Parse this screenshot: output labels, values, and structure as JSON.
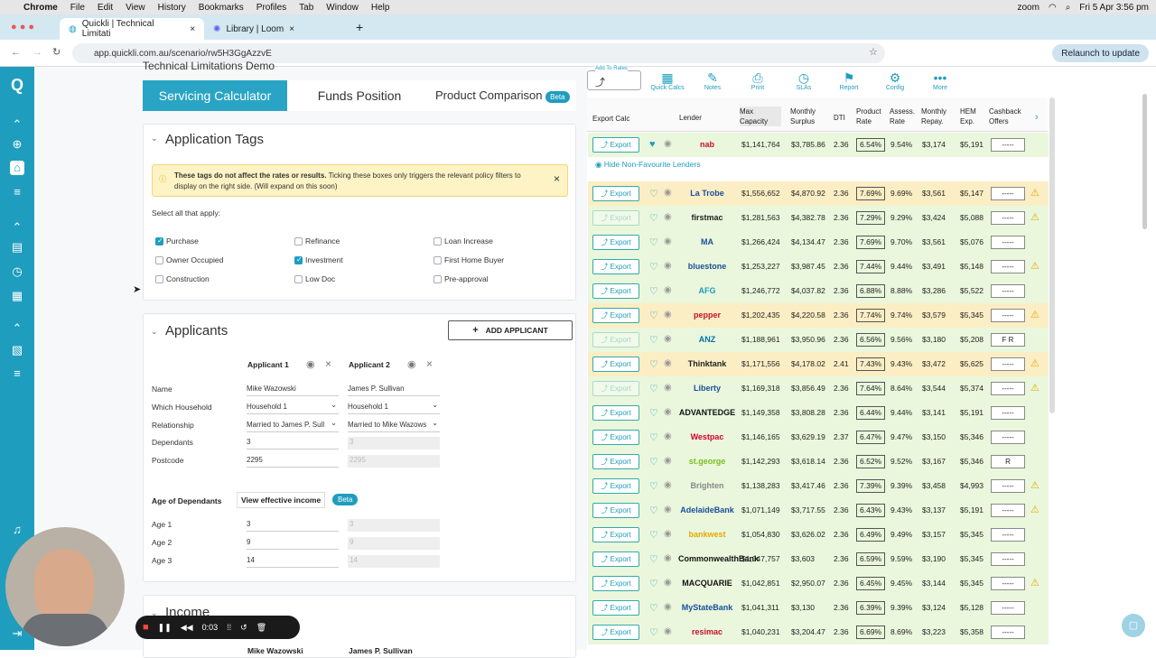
{
  "mac": {
    "menus": [
      "Chrome",
      "File",
      "Edit",
      "View",
      "History",
      "Bookmarks",
      "Profiles",
      "Tab",
      "Window",
      "Help"
    ],
    "clock": "Fri 5 Apr  3:56 pm",
    "zoom": "zoom"
  },
  "tabs": [
    {
      "title": "Quickli | Technical Limitati"
    },
    {
      "title": "Library | Loom"
    }
  ],
  "url": "app.quickli.com.au/scenario/rw5H3GgAzzvE",
  "relaunch": "Relaunch to update",
  "nav": {
    "tabs": [
      "Servicing Calculator",
      "Funds Position",
      "Product Comparison"
    ],
    "beta": "Beta",
    "partial_title": "Technical Limitations Demo"
  },
  "toolbar": {
    "add_to_rates": "Add To Rates",
    "items": [
      "Quick Calcs",
      "Notes",
      "Print",
      "SLAs",
      "Report",
      "Config",
      "More"
    ]
  },
  "tags": {
    "title": "Application Tags",
    "notice_bold": "These tags do not affect the rates or results.",
    "notice": " Ticking these boxes only triggers the relevant policy filters to display on the right side. (Will expand on this soon)",
    "select": "Select all that apply:",
    "options": [
      {
        "l": "Purchase",
        "on": true
      },
      {
        "l": "Refinance",
        "on": false
      },
      {
        "l": "Loan Increase",
        "on": false
      },
      {
        "l": "Owner Occupied",
        "on": false
      },
      {
        "l": "Investment",
        "on": true
      },
      {
        "l": "First Home Buyer",
        "on": false
      },
      {
        "l": "Construction",
        "on": false
      },
      {
        "l": "Low Doc",
        "on": false
      },
      {
        "l": "Pre-approval",
        "on": false
      }
    ]
  },
  "applicants": {
    "title": "Applicants",
    "add": "ADD APPLICANT",
    "a1": "Applicant 1",
    "a2": "Applicant 2",
    "labels": [
      "Name",
      "Which Household",
      "Relationship",
      "Dependants",
      "Postcode"
    ],
    "v1": [
      "Mike Wazowski",
      "Household 1",
      "Married to James P. Sull",
      "3",
      "2295"
    ],
    "v2": [
      "James P. Sullivan",
      "Household 1",
      "Married to Mike Wazows",
      "3",
      "2295"
    ],
    "age_title": "Age of Dependants",
    "view_eff": "View effective income",
    "beta": "Beta",
    "ages": [
      {
        "l": "Age 1",
        "v": "3"
      },
      {
        "l": "Age 2",
        "v": "9"
      },
      {
        "l": "Age 3",
        "v": "14"
      }
    ],
    "income": "Income",
    "inc_names": [
      "Mike Wazowski",
      "James P. Sullivan"
    ]
  },
  "loom": {
    "time": "0:03"
  },
  "table": {
    "headers": [
      "Export Calc",
      "Lender",
      "Max Capacity",
      "Monthly Surplus",
      "DTI",
      "Product Rate",
      "Assess. Rate",
      "Monthly Repay.",
      "HEM Exp.",
      "Cashback Offers"
    ],
    "hide": "Hide Non-Favourite Lenders",
    "export": "Export",
    "rows": [
      {
        "lender": "nab",
        "cap": "$1,141,764",
        "sur": "$3,785.86",
        "dti": "2.36",
        "rate": "6.54%",
        "ass": "9.54%",
        "rep": "$3,174",
        "hem": "$5,191",
        "cash": "-----",
        "warn": false,
        "bg": "#eaf7dc",
        "fav": true,
        "dim": false,
        "col": "#c8102e"
      },
      {
        "lender": "La Trobe",
        "cap": "$1,556,652",
        "sur": "$4,870.92",
        "dti": "2.36",
        "rate": "7.69%",
        "ass": "9.69%",
        "rep": "$3,561",
        "hem": "$5,147",
        "cash": "-----",
        "warn": true,
        "bg": "#fbeec4",
        "fav": false,
        "dim": false,
        "col": "#1a4e9c"
      },
      {
        "lender": "firstmac",
        "cap": "$1,281,563",
        "sur": "$4,382.78",
        "dti": "2.36",
        "rate": "7.29%",
        "ass": "9.29%",
        "rep": "$3,424",
        "hem": "$5,088",
        "cash": "-----",
        "warn": true,
        "bg": "#eaf7dc",
        "fav": false,
        "dim": true,
        "col": "#222"
      },
      {
        "lender": "MA",
        "cap": "$1,266,424",
        "sur": "$4,134.47",
        "dti": "2.36",
        "rate": "7.69%",
        "ass": "9.70%",
        "rep": "$3,561",
        "hem": "$5,076",
        "cash": "-----",
        "warn": false,
        "bg": "#eaf7dc",
        "fav": false,
        "dim": false,
        "col": "#1a4e9c"
      },
      {
        "lender": "bluestone",
        "cap": "$1,253,227",
        "sur": "$3,987.45",
        "dti": "2.36",
        "rate": "7.44%",
        "ass": "9.44%",
        "rep": "$3,491",
        "hem": "$5,148",
        "cash": "-----",
        "warn": true,
        "bg": "#eaf7dc",
        "fav": false,
        "dim": false,
        "col": "#1a4e9c"
      },
      {
        "lender": "AFG",
        "cap": "$1,246,772",
        "sur": "$4,037.82",
        "dti": "2.36",
        "rate": "6.88%",
        "ass": "8.88%",
        "rep": "$3,286",
        "hem": "$5,522",
        "cash": "-----",
        "warn": false,
        "bg": "#eaf7dc",
        "fav": false,
        "dim": false,
        "col": "#1f9dbe"
      },
      {
        "lender": "pepper",
        "cap": "$1,202,435",
        "sur": "$4,220.58",
        "dti": "2.36",
        "rate": "7.74%",
        "ass": "9.74%",
        "rep": "$3,579",
        "hem": "$5,345",
        "cash": "-----",
        "warn": true,
        "bg": "#fbeec4",
        "fav": false,
        "dim": false,
        "col": "#c8102e"
      },
      {
        "lender": "ANZ",
        "cap": "$1,188,961",
        "sur": "$3,950.96",
        "dti": "2.36",
        "rate": "6.56%",
        "ass": "9.56%",
        "rep": "$3,180",
        "hem": "$5,208",
        "cash": "F R",
        "warn": false,
        "bg": "#eaf7dc",
        "fav": false,
        "dim": true,
        "col": "#0072ac"
      },
      {
        "lender": "Thinktank",
        "cap": "$1,171,556",
        "sur": "$4,178.02",
        "dti": "2.41",
        "rate": "7.43%",
        "ass": "9.43%",
        "rep": "$3,472",
        "hem": "$5,625",
        "cash": "-----",
        "warn": true,
        "bg": "#fbeec4",
        "fav": false,
        "dim": false,
        "col": "#222"
      },
      {
        "lender": "Liberty",
        "cap": "$1,169,318",
        "sur": "$3,856.49",
        "dti": "2.36",
        "rate": "7.64%",
        "ass": "8.64%",
        "rep": "$3,544",
        "hem": "$5,374",
        "cash": "-----",
        "warn": true,
        "bg": "#eaf7dc",
        "fav": false,
        "dim": true,
        "col": "#1a4e9c"
      },
      {
        "lender": "ADVANTEDGE",
        "cap": "$1,149,358",
        "sur": "$3,808.28",
        "dti": "2.36",
        "rate": "6.44%",
        "ass": "9.44%",
        "rep": "$3,141",
        "hem": "$5,191",
        "cash": "-----",
        "warn": false,
        "bg": "#eaf7dc",
        "fav": false,
        "dim": false,
        "col": "#111"
      },
      {
        "lender": "Westpac",
        "cap": "$1,146,165",
        "sur": "$3,629.19",
        "dti": "2.37",
        "rate": "6.47%",
        "ass": "9.47%",
        "rep": "$3,150",
        "hem": "$5,346",
        "cash": "-----",
        "warn": false,
        "bg": "#eaf7dc",
        "fav": false,
        "dim": false,
        "col": "#d5002b"
      },
      {
        "lender": "st.george",
        "cap": "$1,142,293",
        "sur": "$3,618.14",
        "dti": "2.36",
        "rate": "6.52%",
        "ass": "9.52%",
        "rep": "$3,167",
        "hem": "$5,346",
        "cash": "R",
        "warn": false,
        "bg": "#eaf7dc",
        "fav": false,
        "dim": false,
        "col": "#78be20"
      },
      {
        "lender": "Brighten",
        "cap": "$1,138,283",
        "sur": "$3,417.46",
        "dti": "2.36",
        "rate": "7.39%",
        "ass": "9.39%",
        "rep": "$3,458",
        "hem": "$4,993",
        "cash": "-----",
        "warn": true,
        "bg": "#eaf7dc",
        "fav": false,
        "dim": false,
        "col": "#888"
      },
      {
        "lender": "AdelaideBank",
        "cap": "$1,071,149",
        "sur": "$3,717.55",
        "dti": "2.36",
        "rate": "6.43%",
        "ass": "9.43%",
        "rep": "$3,137",
        "hem": "$5,191",
        "cash": "-----",
        "warn": true,
        "bg": "#eaf7dc",
        "fav": false,
        "dim": false,
        "col": "#1a4e9c"
      },
      {
        "lender": "bankwest",
        "cap": "$1,054,830",
        "sur": "$3,626.02",
        "dti": "2.36",
        "rate": "6.49%",
        "ass": "9.49%",
        "rep": "$3,157",
        "hem": "$5,345",
        "cash": "-----",
        "warn": false,
        "bg": "#eaf7dc",
        "fav": false,
        "dim": false,
        "col": "#e6a800"
      },
      {
        "lender": "CommonwealthBank",
        "cap": "$1,047,757",
        "sur": "$3,603",
        "dti": "2.36",
        "rate": "6.59%",
        "ass": "9.59%",
        "rep": "$3,190",
        "hem": "$5,345",
        "cash": "-----",
        "warn": false,
        "bg": "#eaf7dc",
        "fav": false,
        "dim": false,
        "col": "#111"
      },
      {
        "lender": "MACQUARIE",
        "cap": "$1,042,851",
        "sur": "$2,950.07",
        "dti": "2.36",
        "rate": "6.45%",
        "ass": "9.45%",
        "rep": "$3,144",
        "hem": "$5,345",
        "cash": "-----",
        "warn": true,
        "bg": "#eaf7dc",
        "fav": false,
        "dim": false,
        "col": "#111"
      },
      {
        "lender": "MyStateBank",
        "cap": "$1,041,311",
        "sur": "$3,130",
        "dti": "2.36",
        "rate": "6.39%",
        "ass": "9.39%",
        "rep": "$3,124",
        "hem": "$5,128",
        "cash": "-----",
        "warn": false,
        "bg": "#eaf7dc",
        "fav": false,
        "dim": false,
        "col": "#1a4e9c"
      },
      {
        "lender": "resimac",
        "cap": "$1,040,231",
        "sur": "$3,204.47",
        "dti": "2.36",
        "rate": "6.69%",
        "ass": "8.69%",
        "rep": "$3,223",
        "hem": "$5,358",
        "cash": "-----",
        "warn": false,
        "bg": "#eaf7dc",
        "fav": false,
        "dim": false,
        "col": "#c8102e"
      }
    ]
  }
}
